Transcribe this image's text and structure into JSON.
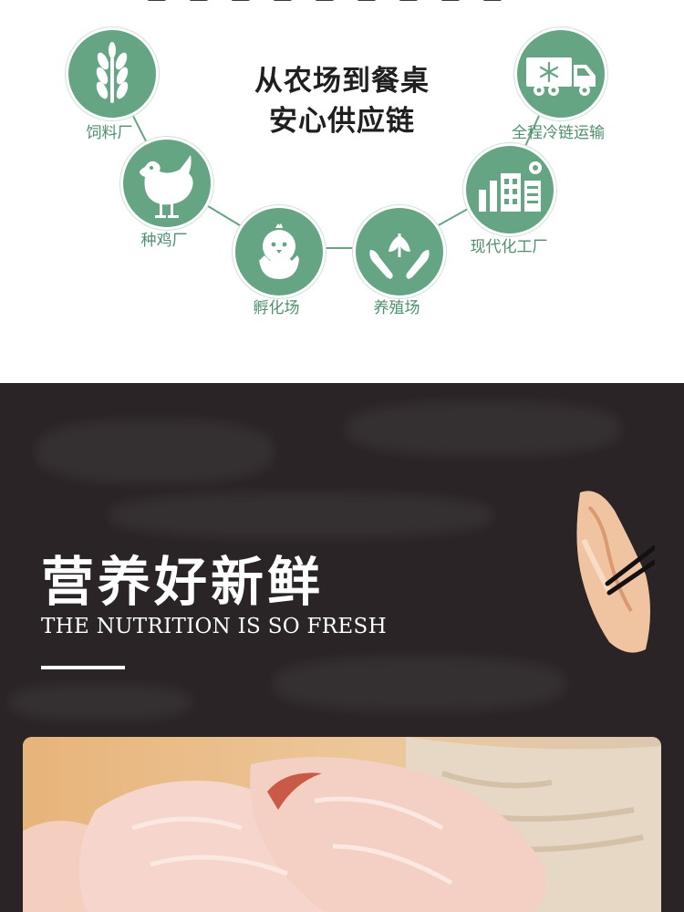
{
  "supply_chain": {
    "headline_line1": "从农场到餐桌",
    "headline_line2": "安心供应链",
    "steps": [
      {
        "label": "饲料厂",
        "icon": "wheat-icon"
      },
      {
        "label": "种鸡厂",
        "icon": "hen-icon"
      },
      {
        "label": "孵化场",
        "icon": "chick-hatching-icon"
      },
      {
        "label": "养殖场",
        "icon": "hands-sprout-icon"
      },
      {
        "label": "现代化工厂",
        "icon": "factory-icon"
      },
      {
        "label": "全程冷链运输",
        "icon": "refrigerated-truck-icon"
      }
    ],
    "accent_color": "#66a584",
    "label_color": "#4f8f6e"
  },
  "nutrition": {
    "title": "营养好新鲜",
    "subtitle": "THE NUTRITION IS SO FRESH",
    "background_color": "#2a2426"
  }
}
